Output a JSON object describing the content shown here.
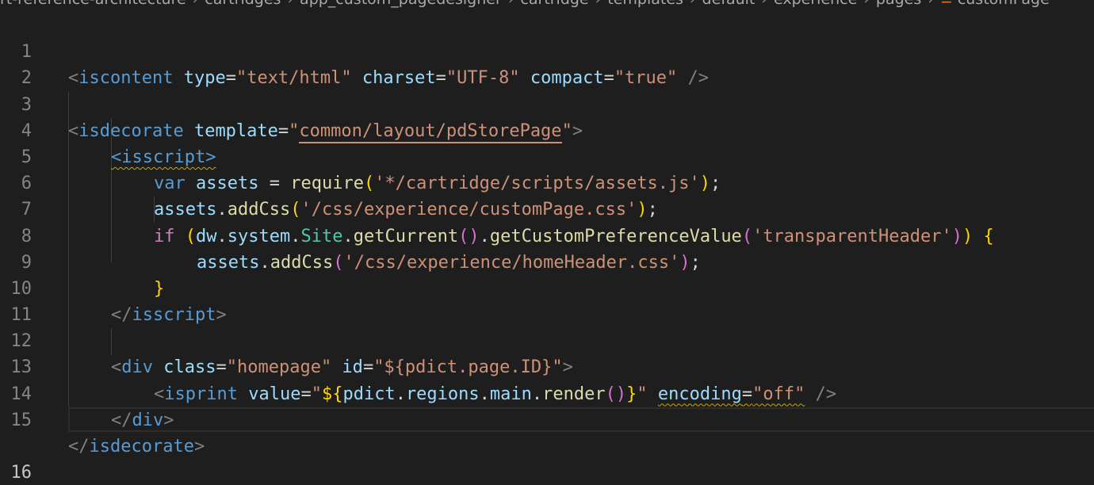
{
  "breadcrumb": [
    "rt-reference-architecture",
    "cartridges",
    "app_custom_pagedesigner",
    "cartridge",
    "templates",
    "default",
    "experience",
    "pages",
    "customPage"
  ],
  "colors": {
    "background": "#1e1e1e",
    "tag": "#569cd6",
    "attribute": "#9cdcfe",
    "string": "#ce9178",
    "function": "#dcdcaa",
    "control": "#c586c0",
    "warning_squiggle": "#cca700"
  },
  "editor": {
    "active_line": "16",
    "lines": [
      {
        "n": "1",
        "t": {
          "a": "<",
          "b": "iscontent",
          "c": " type",
          "d": "=",
          "e": "\"text/html\"",
          "f": " charset",
          "g": "=",
          "h": "\"UTF-8\"",
          "i": " compact",
          "j": "=",
          "k": "\"true\"",
          "l": " />"
        }
      },
      {
        "n": "2"
      },
      {
        "n": "3",
        "t": {
          "a": "<",
          "b": "isdecorate",
          "c": " template",
          "d": "=",
          "e": "\"",
          "f": "common/layout/pdStorePage",
          "g": "\"",
          "h": ">"
        }
      },
      {
        "n": "4",
        "t": {
          "a": "<isscript>"
        }
      },
      {
        "n": "5",
        "t": {
          "a": "var",
          "b": " assets",
          "c": " = ",
          "d": "require",
          "e": "(",
          "f": "'*/cartridge/scripts/assets.js'",
          "g": ")",
          "h": ";"
        }
      },
      {
        "n": "6",
        "t": {
          "a": "assets",
          "b": ".",
          "c": "addCss",
          "d": "(",
          "e": "'/css/experience/customPage.css'",
          "f": ")",
          "g": ";"
        }
      },
      {
        "n": "7",
        "t": {
          "a": "if",
          "b": " (",
          "c": "dw",
          "d": ".",
          "e": "system",
          "f": ".",
          "g": "Site",
          "h": ".",
          "i": "getCurrent",
          "j": "()",
          "k": ".",
          "l": "getCustomPreferenceValue",
          "m": "(",
          "n": "'transparentHeader'",
          "o": ")",
          "p": ")",
          "q": " {"
        }
      },
      {
        "n": "8",
        "t": {
          "a": "assets",
          "b": ".",
          "c": "addCss",
          "d": "(",
          "e": "'/css/experience/homeHeader.css'",
          "f": ")",
          "g": ";"
        }
      },
      {
        "n": "9",
        "t": {
          "a": "}"
        }
      },
      {
        "n": "10",
        "t": {
          "a": "</",
          "b": "isscript",
          "c": ">"
        }
      },
      {
        "n": "11"
      },
      {
        "n": "12",
        "t": {
          "a": "<",
          "b": "div",
          "c": " class",
          "d": "=",
          "e": "\"homepage\"",
          "f": " id",
          "g": "=",
          "h": "\"${pdict.page.ID}\"",
          "i": ">"
        }
      },
      {
        "n": "13",
        "t": {
          "a": "<",
          "b": "isprint",
          "c": " value",
          "d": "=",
          "e": "\"",
          "f": "${",
          "g": "pdict",
          "h": ".",
          "i": "regions",
          "j": ".",
          "k": "main",
          "l": ".",
          "m": "render",
          "n": "()",
          "o": "}",
          "p": "\"",
          "q": "encoding",
          "r": "=",
          "s": "\"off\"",
          "u": " />"
        }
      },
      {
        "n": "14",
        "t": {
          "a": "</",
          "b": "div",
          "c": ">"
        }
      },
      {
        "n": "15",
        "t": {
          "a": "</",
          "b": "isdecorate",
          "c": ">"
        }
      },
      {
        "n": "16"
      }
    ]
  }
}
